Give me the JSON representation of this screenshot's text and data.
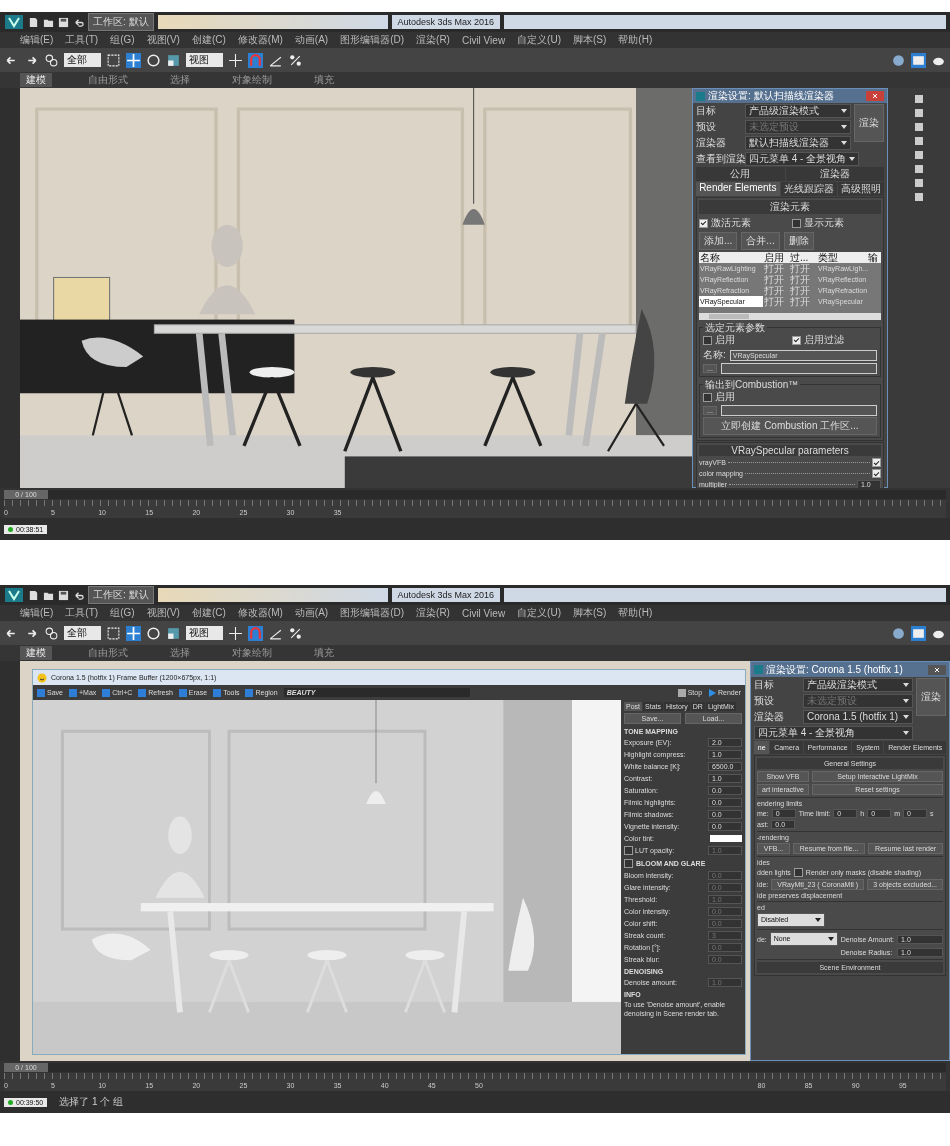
{
  "screens": [
    {
      "kind": "render-elements",
      "chrome": {
        "workspace": "工作区: 默认",
        "title": "Autodesk 3ds Max 2016",
        "menus": [
          "编辑(E)",
          "工具(T)",
          "组(G)",
          "视图(V)",
          "创建(C)",
          "修改器(M)",
          "动画(A)",
          "图形编辑器(D)",
          "渲染(R)",
          "Civil View",
          "自定义(U)",
          "脚本(S)",
          "帮助(H)"
        ],
        "selection_filter": "全部",
        "coordinate": "视图",
        "ribbon_tabs": [
          {
            "label": "建模",
            "selected": true
          },
          {
            "label": "自由形式",
            "selected": false
          },
          {
            "label": "选择",
            "selected": false
          },
          {
            "label": "对象绘制",
            "selected": false
          },
          {
            "label": "填充",
            "selected": false
          }
        ],
        "time_slider": {
          "label": "0 / 100",
          "level": 0
        },
        "ticks": [
          "0",
          "5",
          "10",
          "15",
          "20",
          "25",
          "30",
          "35"
        ],
        "time": "00:38:51"
      },
      "dialog": {
        "title": "渲染设置: 默认扫描线渲染器",
        "render_button": "渲染",
        "fields": [
          {
            "label": "目标",
            "value": "产品级渲染模式",
            "disabled": false
          },
          {
            "label": "预设",
            "value": "未选定预设",
            "disabled": true
          },
          {
            "label": "渲染器",
            "value": "默认扫描线渲染器",
            "disabled": false
          },
          {
            "label": "查看到渲染",
            "value": "四元菜单 4 - 全景视角",
            "disabled": false
          }
        ],
        "tab_rows": [
          [
            {
              "label": "公用",
              "selected": false
            },
            {
              "label": "渲染器",
              "selected": false
            }
          ],
          [
            {
              "label": "Render Elements",
              "selected": true
            },
            {
              "label": "光线跟踪器",
              "selected": false
            },
            {
              "label": "高级照明",
              "selected": false
            }
          ]
        ],
        "elements": {
          "heading": "渲染元素",
          "options": [
            {
              "label": "激活元素",
              "checked": true
            },
            {
              "label": "显示元素",
              "checked": false
            }
          ],
          "buttons": [
            "添加...",
            "合并...",
            "删除"
          ],
          "columns": [
            "名称",
            "启用",
            "过...",
            "类型",
            "输"
          ],
          "rows": [
            {
              "cells": [
                "VRayRawLighting",
                "打开",
                "打开",
                "VRayRawLigh..."
              ],
              "selected": false
            },
            {
              "cells": [
                "VRayReflection",
                "打开",
                "打开",
                "VRayReflection"
              ],
              "selected": false
            },
            {
              "cells": [
                "VRayRefraction",
                "打开",
                "打开",
                "VRayRefraction"
              ],
              "selected": false
            },
            {
              "cells": [
                "VRaySpecular",
                "打开",
                "打开",
                "VRaySpecular"
              ],
              "selected": true
            }
          ]
        },
        "selected_params": {
          "heading": "选定元素参数",
          "options": [
            {
              "label": "启用",
              "checked": false
            },
            {
              "label": "启用过滤",
              "checked": true
            }
          ],
          "name_label": "名称:",
          "name_value": "VRaySpecular",
          "browse": "..."
        },
        "combustion": {
          "heading": "输出到Combustion™",
          "options": [
            {
              "label": "启用",
              "checked": false
            }
          ],
          "browse": "...",
          "create_button": "立即创建 Combustion 工作区..."
        },
        "parameters": {
          "heading": "VRaySpecular parameters",
          "rows": [
            {
              "kind": "check",
              "label": "vrayVFB",
              "checked": true
            },
            {
              "kind": "check",
              "label": "color mapping",
              "checked": true
            },
            {
              "kind": "spinner",
              "label": "multiplier",
              "value": "1.0"
            }
          ]
        }
      }
    },
    {
      "kind": "frame-buffer",
      "chrome": {
        "workspace": "工作区: 默认",
        "title": "Autodesk 3ds Max 2016",
        "menus": [
          "编辑(E)",
          "工具(T)",
          "组(G)",
          "视图(V)",
          "创建(C)",
          "修改器(M)",
          "动画(A)",
          "图形编辑器(D)",
          "渲染(R)",
          "Civil View",
          "自定义(U)",
          "脚本(S)",
          "帮助(H)"
        ],
        "selection_filter": "全部",
        "coordinate": "视图",
        "ribbon_tabs": [
          {
            "label": "建模",
            "selected": true
          },
          {
            "label": "自由形式",
            "selected": false
          },
          {
            "label": "选择",
            "selected": false
          },
          {
            "label": "对象绘制",
            "selected": false
          },
          {
            "label": "填充",
            "selected": false
          }
        ],
        "time_slider": {
          "label": "0 / 100",
          "level": 0
        },
        "ticks": [
          "0",
          "5",
          "10",
          "15",
          "20",
          "25",
          "30",
          "35",
          "40",
          "45",
          "50",
          "80",
          "85",
          "90",
          "95"
        ],
        "time": "00:39:50",
        "prompt": "选择了 1 个 组"
      },
      "frame_buffer": {
        "title": "Corona 1.5 (hotfix 1) Frame Buffer (1200×675px, 1:1)",
        "tools": [
          "Save",
          "+Max",
          "Ctrl+C",
          "Refresh",
          "Erase",
          "Tools",
          "Region"
        ],
        "channel": "BEAUTY",
        "stop": "Stop",
        "render": "Render",
        "tabs": [
          {
            "label": "Post",
            "selected": true
          },
          {
            "label": "Stats",
            "selected": false
          },
          {
            "label": "History",
            "selected": false
          },
          {
            "label": "DR",
            "selected": false
          },
          {
            "label": "LightMix",
            "selected": false
          }
        ],
        "file_buttons": [
          "Save...",
          "Load..."
        ],
        "sections": [
          {
            "title": "TONE MAPPING",
            "kind": "plain",
            "rows": [
              {
                "kind": "spinner",
                "label": "Exposure (EV):",
                "value": "2.0",
                "disabled": false
              },
              {
                "kind": "spinner",
                "label": "Highlight compress:",
                "value": "1.0",
                "disabled": false
              },
              {
                "kind": "spinner",
                "label": "White balance [K]:",
                "value": "6500.0",
                "disabled": false
              },
              {
                "kind": "spinner",
                "label": "Contrast:",
                "value": "1.0",
                "disabled": false
              },
              {
                "kind": "spinner",
                "label": "Saturation:",
                "value": "0.0",
                "disabled": false
              },
              {
                "kind": "spinner",
                "label": "Filmic highlights:",
                "value": "0.0",
                "disabled": false
              },
              {
                "kind": "spinner",
                "label": "Filmic shadows:",
                "value": "0.0",
                "disabled": false
              },
              {
                "kind": "spinner",
                "label": "Vignette intensity:",
                "value": "0.0",
                "disabled": false
              },
              {
                "kind": "color",
                "label": "Color tint:"
              },
              {
                "kind": "check-spinner",
                "label": "LUT opacity:",
                "value": "1.0",
                "checked": false,
                "disabled": true
              }
            ]
          },
          {
            "title": "BLOOM AND GLARE",
            "kind": "toggle",
            "checked": false,
            "rows": [
              {
                "kind": "spinner",
                "label": "Bloom intensity:",
                "value": "0.0",
                "disabled": true
              },
              {
                "kind": "spinner",
                "label": "Glare intensity:",
                "value": "0.0",
                "disabled": true
              },
              {
                "kind": "spinner",
                "label": "Threshold:",
                "value": "1.0",
                "disabled": true
              },
              {
                "kind": "spinner",
                "label": "Color intensity:",
                "value": "0.0",
                "disabled": true
              },
              {
                "kind": "spinner",
                "label": "Color shift:",
                "value": "0.0",
                "disabled": true
              },
              {
                "kind": "spinner",
                "label": "Streak count:",
                "value": "3",
                "disabled": true
              },
              {
                "kind": "spinner",
                "label": "Rotation [°]:",
                "value": "0.0",
                "disabled": true
              },
              {
                "kind": "spinner",
                "label": "Streak blur:",
                "value": "0.0",
                "disabled": true
              }
            ]
          },
          {
            "title": "DENOISING",
            "kind": "plain",
            "rows": [
              {
                "kind": "spinner",
                "label": "Denoise amount:",
                "value": "1.0",
                "disabled": true
              }
            ]
          },
          {
            "title": "INFO",
            "kind": "plain",
            "text": "To use 'Denoise amount', enable denoising in Scene render tab."
          }
        ]
      },
      "dialog": {
        "title": "渲染设置: Corona 1.5 (hotfix 1)",
        "render_button": "渲染",
        "fields": [
          {
            "label": "目标",
            "value": "产品级渲染模式",
            "disabled": false
          },
          {
            "label": "预设",
            "value": "未选定预设",
            "disabled": true
          },
          {
            "label": "渲染器",
            "value": "Corona 1.5 (hotfix 1)",
            "disabled": false
          },
          {
            "value": "四元菜单 4 - 全景视角",
            "disabled": false
          }
        ],
        "tabs": [
          {
            "label": "ne",
            "selected": true
          },
          {
            "label": "Camera",
            "selected": false
          },
          {
            "label": "Performance",
            "selected": false
          },
          {
            "label": "System",
            "selected": false
          },
          {
            "label": "Render Elements",
            "selected": false
          }
        ],
        "heading": "General Settings",
        "groups": [
          {
            "rows": [
              [
                {
                  "kind": "button",
                  "text": "Show VFB"
                },
                {
                  "kind": "button",
                  "text": "Setup Interactive LightMix"
                }
              ],
              [
                {
                  "kind": "button",
                  "text": "art interactive"
                },
                {
                  "kind": "button",
                  "text": "Reset settings"
                }
              ]
            ]
          },
          {
            "heading": "endering limits",
            "rows": [
              [
                {
                  "kind": "text",
                  "text": "me:"
                },
                {
                  "kind": "spinner",
                  "value": "0"
                },
                {
                  "kind": "text",
                  "text": "Time limit:"
                },
                {
                  "kind": "spinner",
                  "value": "0"
                },
                {
                  "kind": "text",
                  "text": "h"
                },
                {
                  "kind": "spinner",
                  "value": "0"
                },
                {
                  "kind": "text",
                  "text": "m"
                },
                {
                  "kind": "spinner",
                  "value": "0"
                },
                {
                  "kind": "text",
                  "text": "s"
                }
              ],
              [
                {
                  "kind": "text",
                  "text": "ast:"
                },
                {
                  "kind": "spinner",
                  "value": "0.0"
                }
              ]
            ]
          },
          {
            "heading": "-rendering",
            "rows": [
              [
                {
                  "kind": "button",
                  "text": "VFB..."
                },
                {
                  "kind": "button",
                  "text": "Resume from file..."
                },
                {
                  "kind": "button",
                  "text": "Resume last render"
                }
              ]
            ]
          },
          {
            "heading": "ides",
            "rows": [
              [
                {
                  "kind": "text",
                  "text": "dden lights"
                },
                {
                  "kind": "check",
                  "text": "Render only masks (disable shading)",
                  "checked": false
                }
              ],
              [
                {
                  "kind": "text",
                  "text": "ide:"
                },
                {
                  "kind": "button",
                  "text": "VRayMtl_23 ( CoronaMtl )"
                },
                {
                  "kind": "button",
                  "text": "3 objects excluded..."
                }
              ],
              [
                {
                  "kind": "text",
                  "text": "ide preserves displacement"
                }
              ]
            ]
          },
          {
            "heading": "ed",
            "rows": [
              [
                {
                  "kind": "dropdown",
                  "text": "Disabled"
                }
              ]
            ]
          },
          {
            "rows": [
              [
                {
                  "kind": "text",
                  "text": "de:"
                },
                {
                  "kind": "dropdown",
                  "text": "None"
                },
                {
                  "kind": "text",
                  "text": "Denoise Amount:"
                },
                {
                  "kind": "spinner",
                  "value": "1.0"
                }
              ],
              [
                {
                  "kind": "gap"
                },
                {
                  "kind": "gap"
                },
                {
                  "kind": "text",
                  "text": "Denoise Radius:"
                },
                {
                  "kind": "spinner",
                  "value": "1.0"
                }
              ]
            ]
          }
        ],
        "footer": "Scene Environment"
      }
    }
  ]
}
